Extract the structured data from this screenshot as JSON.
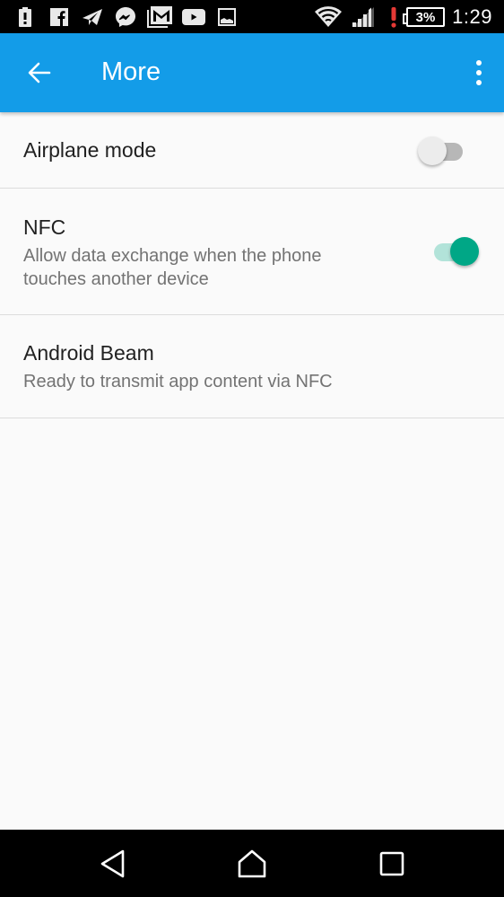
{
  "status_bar": {
    "left_icons": [
      "battery-alert-icon",
      "facebook-icon",
      "telegram-icon",
      "messenger-icon",
      "gmail-icon",
      "youtube-icon",
      "image-icon"
    ],
    "right_icons": [
      "wifi-icon",
      "cell-signal-icon",
      "alert-icon"
    ],
    "battery": "3%",
    "time": "1:29",
    "alert_color": "#e53935"
  },
  "app_bar": {
    "title": "More",
    "back_icon": "arrow-back-icon",
    "menu_icon": "overflow-menu-icon",
    "color": "#139ce8"
  },
  "settings": [
    {
      "title": "Airplane mode",
      "subtitle": "",
      "toggle": "off"
    },
    {
      "title": "NFC",
      "subtitle": "Allow data exchange when the phone touches another device",
      "toggle": "on"
    },
    {
      "title": "Android Beam",
      "subtitle": "Ready to transmit app content via NFC",
      "toggle": null
    }
  ],
  "colors": {
    "toggle_on": "#00a786",
    "toggle_on_track": "#b2e3d9",
    "toggle_off_thumb": "#ececec",
    "toggle_off_track": "#b7b7b7"
  },
  "nav_bar": {
    "buttons": [
      "back",
      "home",
      "recents"
    ]
  }
}
